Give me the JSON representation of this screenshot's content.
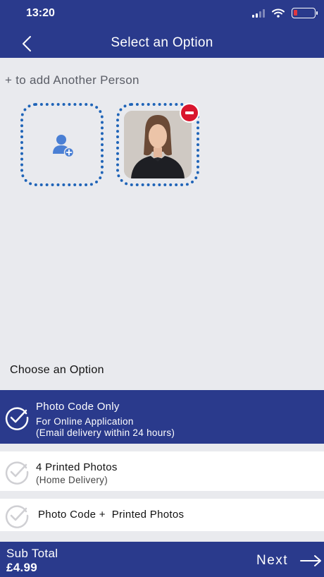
{
  "status_bar": {
    "time": "13:20"
  },
  "header": {
    "title": "Select an Option"
  },
  "people": {
    "add_hint": "+ to add Another Person"
  },
  "options": {
    "heading": "Choose an Option",
    "items": [
      {
        "title": "Photo Code Only",
        "subtitle_1": "For Online Application",
        "subtitle_2": "(Email delivery within 24 hours)",
        "selected": true
      },
      {
        "title": "4 Printed Photos",
        "subtitle_1": "(Home Delivery)",
        "selected": false
      },
      {
        "title": "Photo Code +  Printed Photos",
        "selected": false
      }
    ]
  },
  "footer": {
    "subtotal_label": "Sub Total",
    "subtotal_value": "£4.99",
    "next_label": "Next"
  },
  "colors": {
    "primary": "#2a3a8c",
    "dotted_border": "#1f64b8",
    "remove": "#d9162e",
    "background": "#e9eaee"
  }
}
